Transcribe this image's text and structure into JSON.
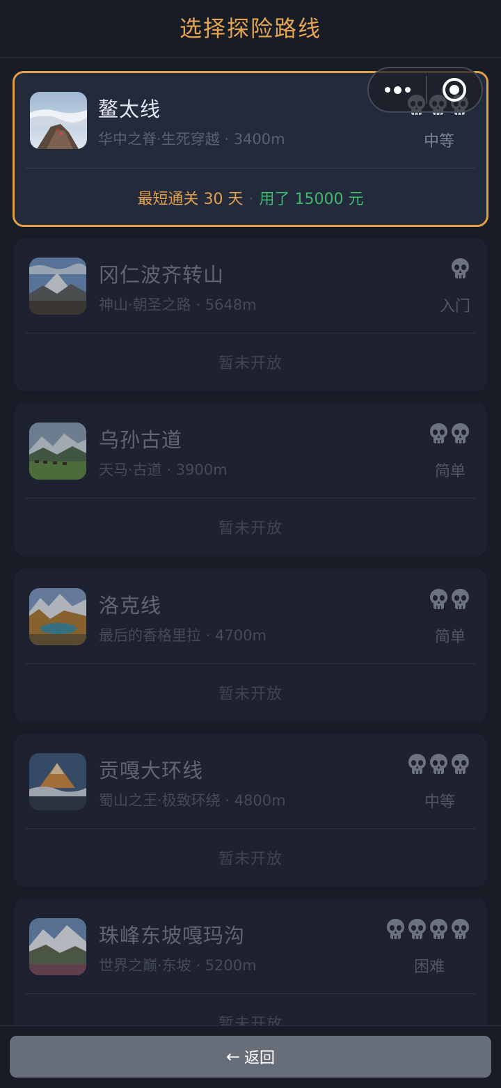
{
  "header": {
    "title": "选择探险路线"
  },
  "capsule": {
    "more_icon": "more-dots-icon",
    "close_icon": "target-circle-icon"
  },
  "routes": [
    {
      "name": "鳌太线",
      "subtitle": "华中之脊·生死穿越 · 3400m",
      "skull_count": 3,
      "difficulty": "中等",
      "footer_days": "最短通关 30 天",
      "footer_sep": "·",
      "footer_cost": "用了 15000 元",
      "active": true
    },
    {
      "name": "冈仁波齐转山",
      "subtitle": "神山·朝圣之路 · 5648m",
      "skull_count": 1,
      "difficulty": "入门",
      "footer": "暂未开放"
    },
    {
      "name": "乌孙古道",
      "subtitle": "天马·古道 · 3900m",
      "skull_count": 2,
      "difficulty": "简单",
      "footer": "暂未开放"
    },
    {
      "name": "洛克线",
      "subtitle": "最后的香格里拉 · 4700m",
      "skull_count": 2,
      "difficulty": "简单",
      "footer": "暂未开放"
    },
    {
      "name": "贡嘎大环线",
      "subtitle": "蜀山之王·极致环绕 · 4800m",
      "skull_count": 3,
      "difficulty": "中等",
      "footer": "暂未开放"
    },
    {
      "name": "珠峰东坡嘎玛沟",
      "subtitle": "世界之巅·东坡 · 5200m",
      "skull_count": 4,
      "difficulty": "困难",
      "footer": "暂未开放"
    }
  ],
  "bottom": {
    "back_arrow": "←",
    "back_label": "返回"
  },
  "colors": {
    "accent": "#e0a047",
    "cost": "#3fb96c",
    "background": "#181c26"
  }
}
